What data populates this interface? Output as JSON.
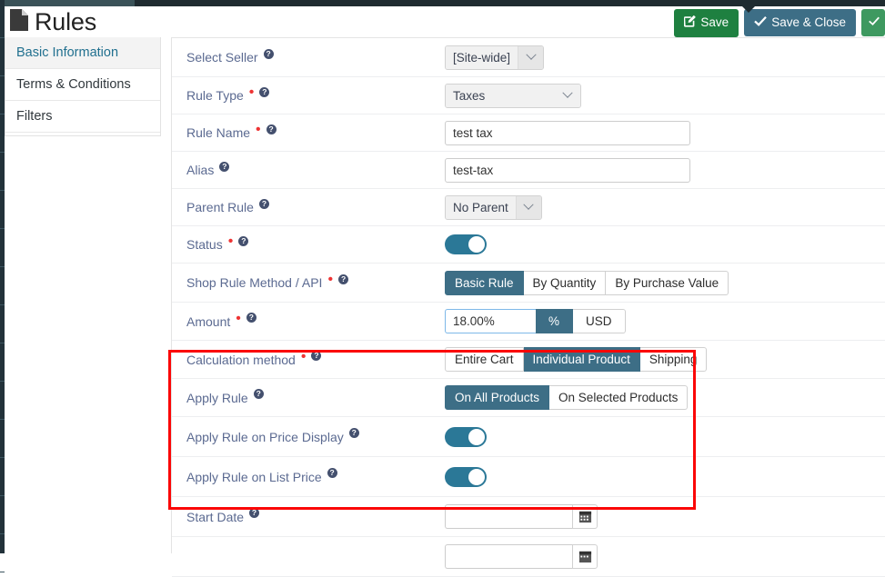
{
  "topbar": {
    "caret_icon": "dropdown-caret"
  },
  "header": {
    "title": "Rules",
    "doc_icon": "document-icon",
    "actions": [
      {
        "label": "Save",
        "icon": "pencil-square-icon",
        "style": "green"
      },
      {
        "label": "Save & Close",
        "icon": "check-icon",
        "style": "blue"
      },
      {
        "label": "",
        "icon": "partial-icon",
        "style": "green-light"
      }
    ]
  },
  "sidebar": {
    "items": [
      {
        "label": "Basic Information",
        "active": true
      },
      {
        "label": "Terms & Conditions",
        "active": false
      },
      {
        "label": "Filters",
        "active": false
      }
    ]
  },
  "form": {
    "select_seller": {
      "label": "Select Seller",
      "required": false,
      "value": "[Site-wide]",
      "help_icon": "help-circle-icon"
    },
    "rule_type": {
      "label": "Rule Type",
      "required": true,
      "value": "Taxes",
      "help_icon": "help-circle-icon"
    },
    "rule_name": {
      "label": "Rule Name",
      "required": true,
      "value": "test tax",
      "placeholder": "",
      "help_icon": "help-circle-icon"
    },
    "alias": {
      "label": "Alias",
      "required": false,
      "value": "test-tax",
      "placeholder": "",
      "help_icon": "help-circle-icon"
    },
    "parent_rule": {
      "label": "Parent Rule",
      "required": false,
      "value": "No Parent",
      "help_icon": "help-circle-icon"
    },
    "status": {
      "label": "Status",
      "required": true,
      "value": "on",
      "help_icon": "help-circle-icon"
    },
    "shop_rule_method": {
      "label": "Shop Rule Method / API",
      "required": true,
      "help_icon": "help-circle-icon",
      "options": [
        "Basic Rule",
        "By Quantity",
        "By Purchase Value"
      ],
      "selected": "Basic Rule"
    },
    "amount": {
      "label": "Amount",
      "required": true,
      "help_icon": "help-circle-icon",
      "value": "18.00%",
      "units": [
        "%",
        "USD"
      ],
      "selected_unit": "%"
    },
    "calculation_method": {
      "label": "Calculation method",
      "required": true,
      "help_icon": "help-circle-icon",
      "options": [
        "Entire Cart",
        "Individual Product",
        "Shipping"
      ],
      "selected": "Individual Product"
    },
    "apply_rule": {
      "label": "Apply Rule",
      "required": false,
      "help_icon": "help-circle-icon",
      "options": [
        "On All Products",
        "On Selected Products"
      ],
      "selected": "On All Products"
    },
    "apply_rule_price_display": {
      "label": "Apply Rule on Price Display",
      "required": false,
      "value": "on",
      "help_icon": "help-circle-icon"
    },
    "apply_rule_list_price": {
      "label": "Apply Rule on List Price",
      "required": false,
      "value": "on",
      "help_icon": "help-circle-icon"
    },
    "start_date": {
      "label": "Start Date",
      "required": false,
      "help_icon": "help-circle-icon",
      "value": "",
      "placeholder": "",
      "calendar_icon": "calendar-icon"
    }
  },
  "colors": {
    "accent_blue": "#3d6e86",
    "toggle_on": "#2b7897",
    "save_green": "#1e8040",
    "highlight_red": "#fb0707",
    "label_text": "#5b6a91",
    "nav_active": "#21708f"
  }
}
